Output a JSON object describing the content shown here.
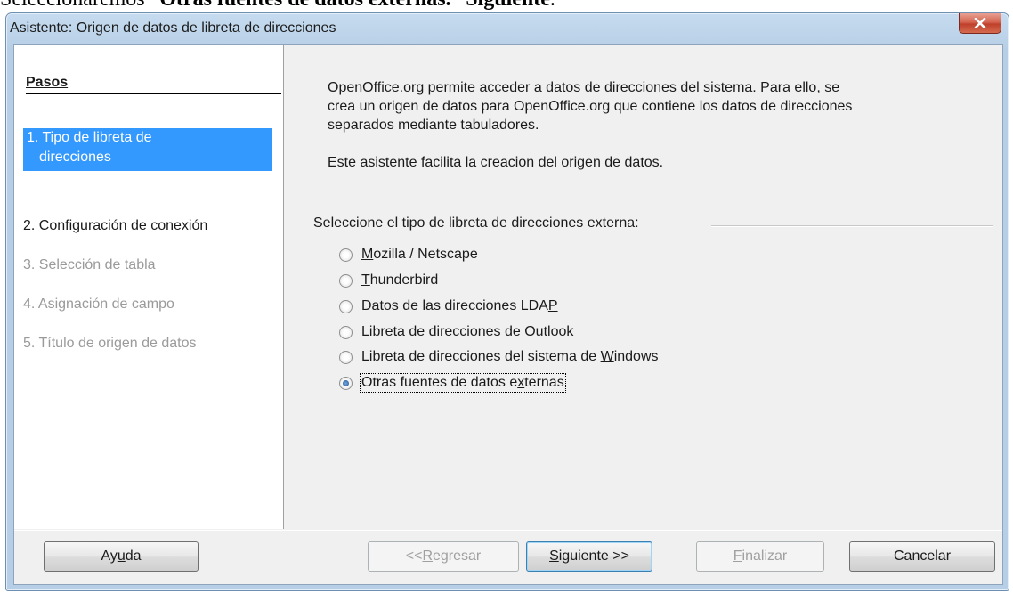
{
  "caption": {
    "prefix": "Seleccionaremos “",
    "bold1": "Otras fuentes de datos externas.",
    "middle": "” ",
    "bold2": "Siguiente",
    "suffix": "."
  },
  "window": {
    "title": "Asistente: Origen de datos de libreta de direcciones",
    "close_icon": "close-icon"
  },
  "steps": {
    "header": "Pasos",
    "items": [
      {
        "line1": "1. Tipo de libreta de",
        "line2": "direcciones",
        "state": "active"
      },
      {
        "line1": "2. Configuración de conexión",
        "state": "enabled"
      },
      {
        "line1": "3. Selección de tabla",
        "state": "disabled"
      },
      {
        "line1": "4. Asignación de campo",
        "state": "disabled"
      },
      {
        "line1": "5. Título de origen de datos",
        "state": "disabled"
      }
    ]
  },
  "main": {
    "intro_lines": [
      "OpenOffice.org permite acceder a datos de direcciones del sistema. Para ello, se",
      "crea un origen de datos para OpenOffice.org que contiene los datos de direcciones",
      "separados mediante tabuladores."
    ],
    "intro2": "Este asistente facilita la creacion del origen de datos.",
    "group_label": "Seleccione el tipo de libreta de direcciones externa:",
    "options": [
      {
        "pre": "",
        "u": "M",
        "post": "ozilla / Netscape",
        "checked": false
      },
      {
        "pre": "",
        "u": "T",
        "post": "hunderbird",
        "checked": false
      },
      {
        "pre": "Datos de las direcciones LDA",
        "u": "P",
        "post": "",
        "checked": false
      },
      {
        "pre": "Libreta de direcciones de Outloo",
        "u": "k",
        "post": "",
        "checked": false
      },
      {
        "pre": "Libreta de direcciones del sistema de ",
        "u": "W",
        "post": "indows",
        "checked": false
      },
      {
        "pre": "Otras fuentes de datos e",
        "u": "x",
        "post": "ternas",
        "checked": true
      }
    ]
  },
  "buttons": {
    "help": {
      "pre": "Ay",
      "u": "u",
      "post": "da"
    },
    "back": {
      "pre": "<< ",
      "u": "R",
      "post": "egresar"
    },
    "next": {
      "pre": "",
      "u": "S",
      "post": "iguiente >>"
    },
    "finish": {
      "pre": "",
      "u": "F",
      "post": "inalizar"
    },
    "cancel": {
      "pre": "",
      "u": "",
      "post": "Cancelar"
    }
  }
}
